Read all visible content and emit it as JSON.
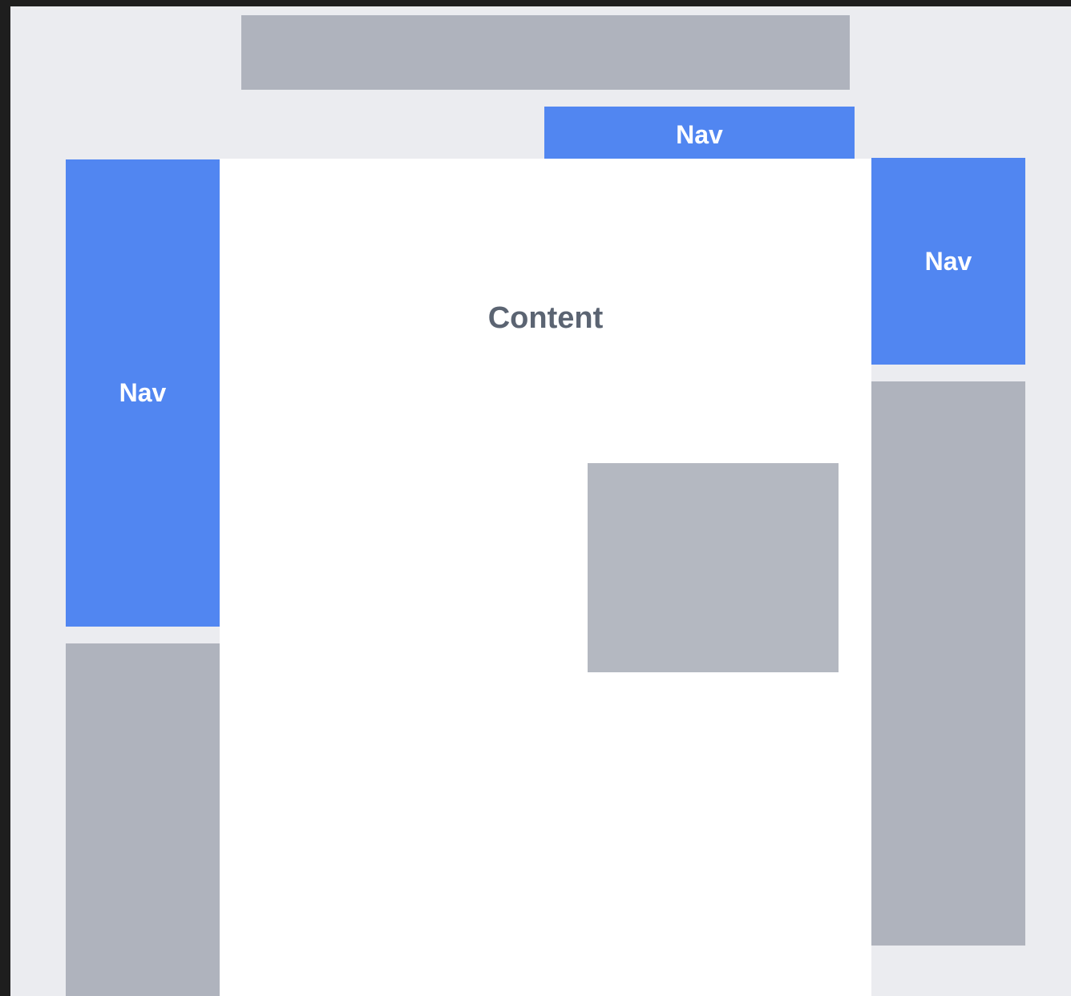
{
  "colors": {
    "background": "#ebecf0",
    "outer": "#1e1e1e",
    "nav": "#5186f1",
    "nav_text": "#ffffff",
    "placeholder": "#afb3bd",
    "placeholder_inner": "#b4b8c1",
    "content_bg": "#ffffff",
    "content_text": "#5b6472"
  },
  "top_nav": {
    "label": "Nav"
  },
  "left_nav": {
    "label": "Nav"
  },
  "right_nav": {
    "label": "Nav"
  },
  "main": {
    "title": "Content"
  }
}
